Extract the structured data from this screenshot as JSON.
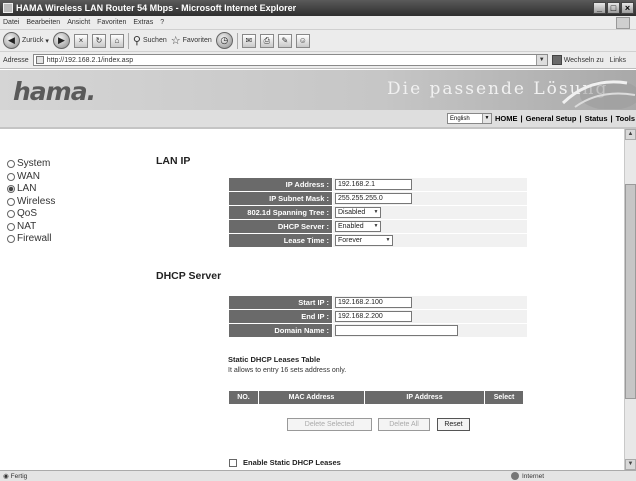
{
  "window": {
    "title": "HAMA Wireless LAN Router 54 Mbps - Microsoft Internet Explorer",
    "minimize": "_",
    "maximize": "□",
    "close": "×"
  },
  "menubar": {
    "items": [
      "Datei",
      "Bearbeiten",
      "Ansicht",
      "Favoriten",
      "Extras",
      "?"
    ]
  },
  "toolbar": {
    "back_label": "Zurück",
    "search_label": "Suchen",
    "favorites_label": "Favoriten"
  },
  "addressbar": {
    "label": "Adresse",
    "url": "http://192.168.2.1/index.asp",
    "go_label": "Wechseln zu",
    "links_label": "Links"
  },
  "banner": {
    "logo": "hama.",
    "slogan": "Die passende Lösung"
  },
  "topnav": {
    "language": "English",
    "items": [
      "HOME",
      "General Setup",
      "Status",
      "Tools"
    ]
  },
  "sidebar": {
    "items": [
      {
        "label": "System",
        "selected": false
      },
      {
        "label": "WAN",
        "selected": false
      },
      {
        "label": "LAN",
        "selected": true
      },
      {
        "label": "Wireless",
        "selected": false
      },
      {
        "label": "QoS",
        "selected": false
      },
      {
        "label": "NAT",
        "selected": false
      },
      {
        "label": "Firewall",
        "selected": false
      }
    ]
  },
  "lan_ip": {
    "title": "LAN IP",
    "ip_address_label": "IP Address :",
    "ip_address": "192.168.2.1",
    "subnet_label": "IP Subnet Mask :",
    "subnet": "255.255.255.0",
    "spanning_label": "802.1d Spanning Tree :",
    "spanning": "Disabled",
    "dhcp_label": "DHCP Server :",
    "dhcp": "Enabled",
    "lease_label": "Lease Time :",
    "lease": "Forever"
  },
  "dhcp_server": {
    "title": "DHCP Server",
    "start_label": "Start IP :",
    "start_ip": "192.168.2.100",
    "end_label": "End IP :",
    "end_ip": "192.168.2.200",
    "domain_label": "Domain Name :",
    "domain": ""
  },
  "static_leases": {
    "title": "Static DHCP Leases Table",
    "note": "It allows to entry 16 sets address only.",
    "columns": [
      "NO.",
      "MAC Address",
      "IP Address",
      "Select"
    ],
    "delete_selected": "Delete Selected",
    "delete_all": "Delete All",
    "reset": "Reset",
    "enable_label": "Enable Static DHCP Leases"
  },
  "statusbar": {
    "left": "Fertig",
    "zone": "Internet"
  }
}
